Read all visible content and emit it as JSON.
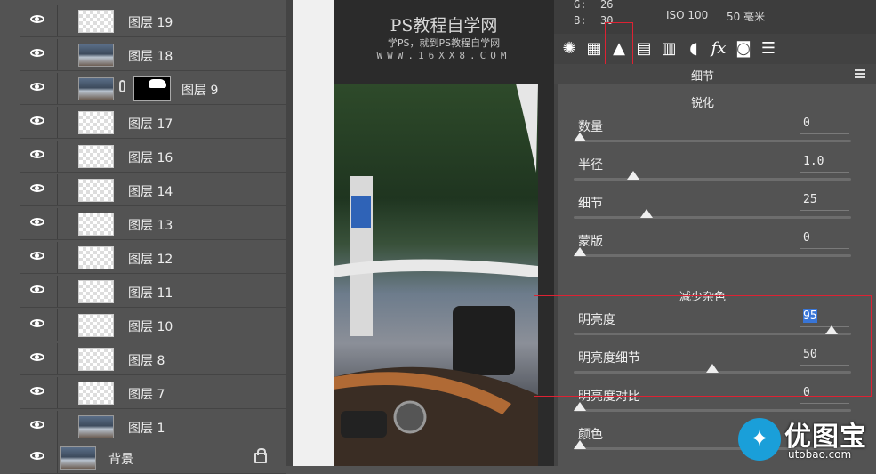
{
  "layers_panel": {
    "rows": [
      {
        "name": "图层 19"
      },
      {
        "name": "图层 18"
      },
      {
        "name": "图层 9"
      },
      {
        "name": "图层 17"
      },
      {
        "name": "图层 16"
      },
      {
        "name": "图层 14"
      },
      {
        "name": "图层 13"
      },
      {
        "name": "图层 12"
      },
      {
        "name": "图层 11"
      },
      {
        "name": "图层 10"
      },
      {
        "name": "图层 8"
      },
      {
        "name": "图层 7"
      },
      {
        "name": "图层 1"
      },
      {
        "name": "背景"
      }
    ]
  },
  "watermark": {
    "title": "PS教程自学网",
    "subtitle": "学PS，就到PS教程自学网",
    "url": "WWW.16XX8.COM"
  },
  "camera_raw": {
    "readout": {
      "g_label": "G:",
      "g_value": "26",
      "b_label": "B:",
      "b_value": "30",
      "iso": "ISO 100",
      "focal": "50 毫米"
    },
    "tool_icons": [
      "aperture-icon",
      "grid-icon",
      "detail-icon",
      "split-toning-icon",
      "hsl-icon",
      "lens-icon",
      "fx-icon",
      "camera-icon",
      "presets-icon"
    ],
    "section_title": "细节",
    "sharpen": {
      "title": "锐化",
      "sliders": [
        {
          "label": "数量",
          "value": "0",
          "level": 0.0
        },
        {
          "label": "半径",
          "value": "1.0",
          "level": 0.2
        },
        {
          "label": "细节",
          "value": "25",
          "level": 0.25
        },
        {
          "label": "蒙版",
          "value": "0",
          "level": 0.0
        }
      ]
    },
    "noise_reduction": {
      "title": "减少杂色",
      "sliders": [
        {
          "label": "明亮度",
          "value": "95",
          "level": 0.95,
          "selected": true
        },
        {
          "label": "明亮度细节",
          "value": "50",
          "level": 0.5
        },
        {
          "label": "明亮度对比",
          "value": "0",
          "level": 0.0
        },
        {
          "label": "颜色",
          "value": "",
          "level": 0.0
        }
      ]
    }
  },
  "logo": {
    "text": "优图宝",
    "url": "utobao.com"
  },
  "colors": {
    "accent": "#3875d7",
    "highlight_box": "#dd2233",
    "panel_bg": "#535353"
  }
}
